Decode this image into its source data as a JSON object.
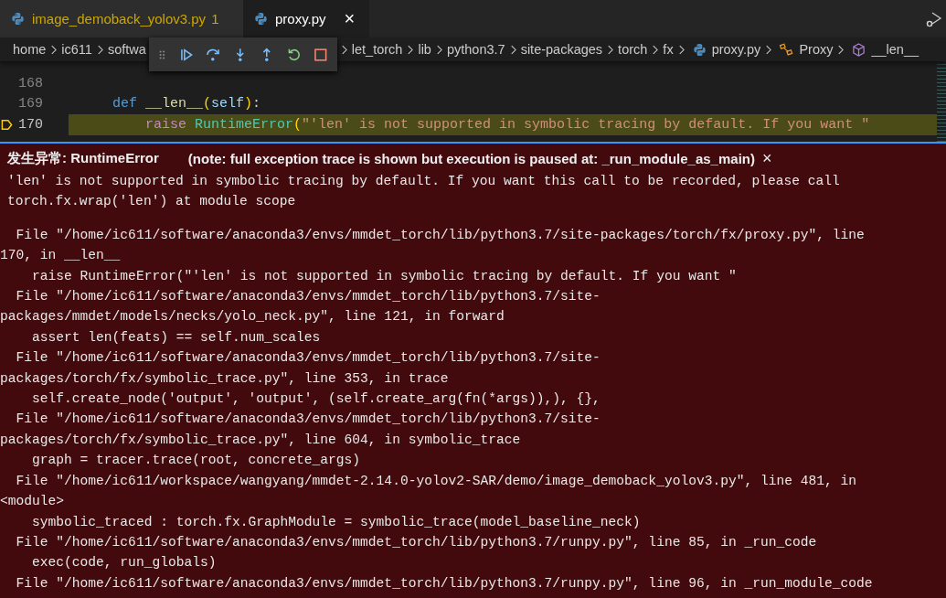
{
  "tabs": [
    {
      "label": "image_demoback_yolov3.py",
      "badge": "1",
      "selected": false,
      "warning": true
    },
    {
      "label": "proxy.py",
      "selected": true,
      "warning": false,
      "close": "×"
    }
  ],
  "breadcrumb": [
    {
      "label": "home",
      "kind": "folder"
    },
    {
      "label": "ic611",
      "kind": "folder"
    },
    {
      "label": "softwa",
      "kind": "cut"
    },
    {
      "label": "let_torch",
      "kind": "folder"
    },
    {
      "label": "lib",
      "kind": "folder"
    },
    {
      "label": "python3.7",
      "kind": "folder"
    },
    {
      "label": "site-packages",
      "kind": "folder"
    },
    {
      "label": "torch",
      "kind": "folder"
    },
    {
      "label": "fx",
      "kind": "folder"
    },
    {
      "label": "proxy.py",
      "kind": "file"
    },
    {
      "label": "Proxy",
      "kind": "class"
    },
    {
      "label": "__len__",
      "kind": "method"
    }
  ],
  "code_lines": [
    {
      "number": "168",
      "current": false
    },
    {
      "number": "169",
      "current": false,
      "tokens": [
        {
          "text": "    def",
          "kind": "def"
        },
        {
          "text": " __len__",
          "kind": "func"
        },
        {
          "text": "(",
          "kind": "bracket"
        },
        {
          "text": "self",
          "kind": "param"
        },
        {
          "text": ")",
          "kind": "bracket"
        },
        {
          "text": ":",
          "kind": "plain"
        }
      ]
    },
    {
      "number": "170",
      "current": true,
      "tokens": [
        {
          "text": "        raise",
          "kind": "keyword"
        },
        {
          "text": " RuntimeError",
          "kind": "class"
        },
        {
          "text": "(",
          "kind": "bracket"
        },
        {
          "text": "\"'len' is not supported in symbolic tracing by default. If you want \"",
          "kind": "string"
        }
      ]
    }
  ],
  "exception": {
    "title": "发生异常: RuntimeError",
    "note": "(note: full exception trace is shown but execution is paused at: _run_module_as_main)",
    "close": "×",
    "message": [
      "'len' is not supported in symbolic tracing by default. If you want this call to be recorded, please call",
      "torch.fx.wrap('len') at module scope"
    ],
    "trace": [
      "  File \"/home/ic611/software/anaconda3/envs/mmdet_torch/lib/python3.7/site-packages/torch/fx/proxy.py\", line",
      "170, in __len__",
      "    raise RuntimeError(\"'len' is not supported in symbolic tracing by default. If you want \"",
      "  File \"/home/ic611/software/anaconda3/envs/mmdet_torch/lib/python3.7/site-",
      "packages/mmdet/models/necks/yolo_neck.py\", line 121, in forward",
      "    assert len(feats) == self.num_scales",
      "  File \"/home/ic611/software/anaconda3/envs/mmdet_torch/lib/python3.7/site-",
      "packages/torch/fx/symbolic_trace.py\", line 353, in trace",
      "    self.create_node('output', 'output', (self.create_arg(fn(*args)),), {},",
      "  File \"/home/ic611/software/anaconda3/envs/mmdet_torch/lib/python3.7/site-",
      "packages/torch/fx/symbolic_trace.py\", line 604, in symbolic_trace",
      "    graph = tracer.trace(root, concrete_args)",
      "  File \"/home/ic611/workspace/wangyang/mmdet-2.14.0-yolov2-SAR/demo/image_demoback_yolov3.py\", line 481, in",
      "<module>",
      "    symbolic_traced : torch.fx.GraphModule = symbolic_trace(model_baseline_neck)",
      "  File \"/home/ic611/software/anaconda3/envs/mmdet_torch/lib/python3.7/runpy.py\", line 85, in _run_code",
      "    exec(code, run_globals)",
      "  File \"/home/ic611/software/anaconda3/envs/mmdet_torch/lib/python3.7/runpy.py\", line 96, in _run_module_code"
    ]
  }
}
